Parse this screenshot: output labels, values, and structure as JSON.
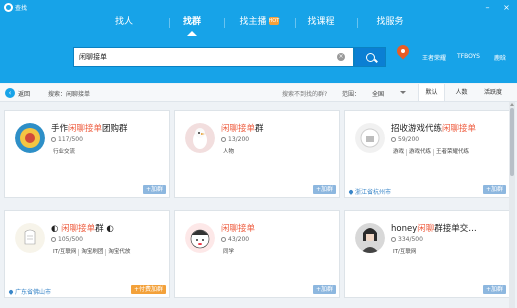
{
  "window": {
    "title": "查找"
  },
  "tabs": [
    {
      "label": "找人"
    },
    {
      "label": "找群"
    },
    {
      "label": "找主播",
      "badge": "hot"
    },
    {
      "label": "找课程"
    },
    {
      "label": "找服务"
    }
  ],
  "search": {
    "value": "闲聊接单"
  },
  "hot_words": [
    "王者荣耀",
    "TFBOYS",
    "鹿晗"
  ],
  "filter": {
    "back_label": "返回",
    "query_label": "搜索：闲聊接单",
    "hint": "搜索不到找的群?",
    "range_label": "范围：",
    "range_value": "全国",
    "sort": [
      "默认",
      "人数",
      "活跃度"
    ]
  },
  "cards": [
    {
      "name_pre": "手作",
      "name_hl": "闲聊接单",
      "name_post": "团购群",
      "members": "117/500",
      "tags": [
        "行业交流"
      ],
      "location": "",
      "join": "+加群",
      "join_style": "blue"
    },
    {
      "name_pre": "",
      "name_hl": "闲聊接单",
      "name_post": "群",
      "members": "13/200",
      "tags": [
        "人物"
      ],
      "location": "",
      "join": "+加群",
      "join_style": "blue"
    },
    {
      "name_pre": "招收游戏代练",
      "name_hl": "闲聊接单",
      "name_post": "",
      "members": "59/200",
      "tags": [
        "游戏",
        "游戏代练",
        "王者荣耀代练"
      ],
      "location": "浙江省杭州市",
      "join": "+加群",
      "join_style": "blue"
    },
    {
      "name_pre": "◐ ",
      "name_hl": "闲聊接单",
      "name_post": "群 ◐",
      "members": "105/500",
      "tags": [
        "IT/互联网",
        "淘宝刷团",
        "淘宝代放"
      ],
      "location": "广东省佛山市",
      "join": "+付费加群",
      "join_style": "orange"
    },
    {
      "name_pre": "",
      "name_hl": "闲聊接单",
      "name_post": "",
      "members": "43/200",
      "tags": [
        "同学"
      ],
      "location": "",
      "join": "+加群",
      "join_style": "blue"
    },
    {
      "name_pre": "honey",
      "name_hl": "闲聊",
      "name_post": "群接单交…",
      "members": "334/500",
      "tags": [
        "IT/互联网"
      ],
      "location": "",
      "join": "+加群",
      "join_style": "blue"
    }
  ]
}
